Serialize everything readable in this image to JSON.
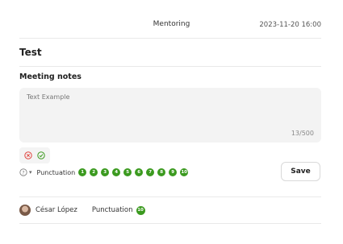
{
  "header": {
    "title": "Mentoring",
    "datetime": "2023-11-20 16:00"
  },
  "entry": {
    "title": "Test"
  },
  "notes": {
    "label": "Meeting notes",
    "text": "Text Example",
    "char_count": "13/500"
  },
  "actions": {
    "cancel_icon": "x-circle-icon",
    "confirm_icon": "check-circle-icon"
  },
  "rating": {
    "help_icon": "question-circle-icon",
    "label": "Punctuation",
    "options": [
      "1",
      "2",
      "3",
      "4",
      "5",
      "6",
      "7",
      "8",
      "9",
      "10"
    ],
    "color": "#3b9a1f"
  },
  "save_label": "Save",
  "author": {
    "name": "César López",
    "score_label": "Punctuation",
    "score": "10"
  }
}
